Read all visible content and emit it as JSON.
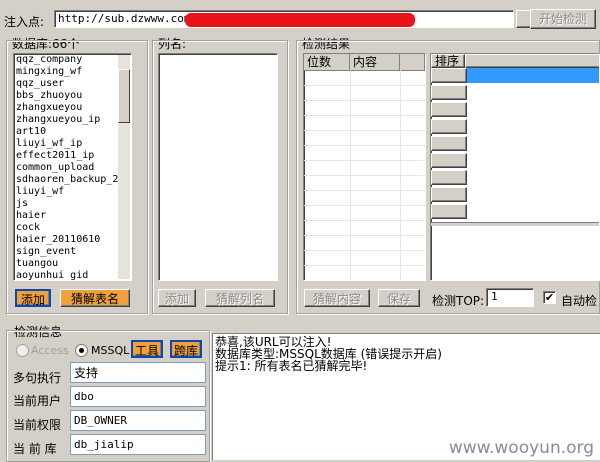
{
  "inject": {
    "label": "注入点:",
    "url_prefix": "http://sub.dzwww.com/",
    "start_button": "开始检测"
  },
  "db_panel": {
    "title": "数据库:66个",
    "items": [
      "qqz_company",
      "mingxing_wf",
      "qqz_user",
      "bbs_zhuoyou",
      "zhangxueyou",
      "zhangxueyou_ip",
      "art10",
      "liuyi_wf_ip",
      "effect2011_ip",
      "common_upload",
      "sdhaoren_backup_2",
      "liuyi_wf",
      "js",
      "haier",
      "cock",
      "haier_20110610",
      "sign_event",
      "tuangou",
      "aoyunhui_gid"
    ],
    "add_button": "添加",
    "guess_button": "猜解表名"
  },
  "col_panel": {
    "title": "列名:",
    "add_button": "添加",
    "guess_button": "猜解列名"
  },
  "result_panel": {
    "title": "检测结果",
    "col_num": "位数",
    "col_content": "内容",
    "sort_header": "排序",
    "guess_content_button": "猜解内容",
    "save_button": "保存",
    "top_label": "检测TOP:",
    "top_value": "1",
    "auto_label": "自动检"
  },
  "detect": {
    "title": "检测信息",
    "access_label": "Access",
    "mssql_label": "MSSQL",
    "tools_button": "工具",
    "cross_button": "跨库",
    "multi_label": "多句执行",
    "multi_value": "支持",
    "user_label": "当前用户",
    "user_value": "dbo",
    "perm_label": "当前权限",
    "perm_value": "DB_OWNER",
    "db_label": "当 前 库",
    "db_value": "db_jialip"
  },
  "messages": [
    "恭喜,该URL可以注入!",
    "数据库类型:MSSQL数据库 (错误提示开启)",
    "提示1: 所有表名已猜解完毕!"
  ],
  "watermark": "www.wooyun.org",
  "colors": {
    "accent": "#f0a03a",
    "selection": "#3399ff",
    "redact": "#e8141a",
    "window": "#d4d0c8"
  }
}
